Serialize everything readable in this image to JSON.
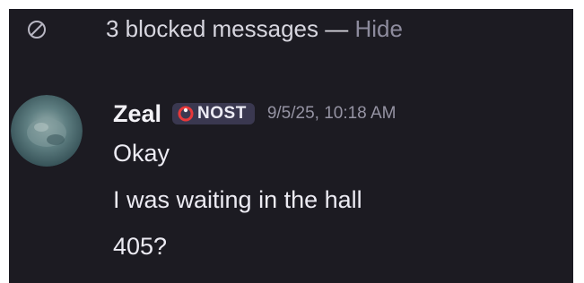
{
  "blocked": {
    "count_text": "3 blocked messages",
    "separator": "—",
    "hide_label": "Hide",
    "icon": "blocked-circle-icon"
  },
  "message": {
    "username": "Zeal",
    "badge": {
      "label": "NOST",
      "icon": "red-ring-icon"
    },
    "timestamp": "9/5/25, 10:18 AM",
    "lines": [
      "Okay",
      "I was waiting in the hall",
      "405?"
    ]
  },
  "colors": {
    "background": "#1c1b22",
    "text": "#ecebf3",
    "muted": "#8d8b9d",
    "badge_bg": "#3a3850",
    "badge_icon": "#e8383a"
  }
}
